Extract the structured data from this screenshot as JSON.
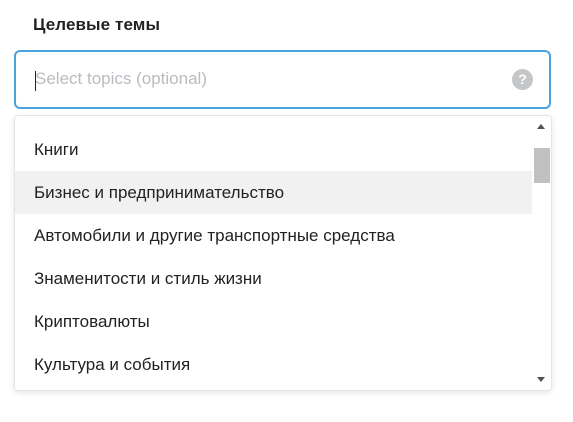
{
  "field": {
    "label": "Целевые темы",
    "placeholder": "Select topics (optional)",
    "help_glyph": "?",
    "help_icon": "question-circle-icon",
    "accent_color": "#4aa3df"
  },
  "dropdown": {
    "options": [
      {
        "label": "Книги"
      },
      {
        "label": "Бизнес и предпринимательство",
        "state": "hover"
      },
      {
        "label": "Автомобили и другие транспортные средства"
      },
      {
        "label": "Знаменитости и стиль жизни"
      },
      {
        "label": "Криптовалюты"
      },
      {
        "label": "Культура и события"
      }
    ],
    "scrollbar": {
      "up_icon": "arrow-up-icon",
      "down_icon": "arrow-down-icon"
    }
  }
}
